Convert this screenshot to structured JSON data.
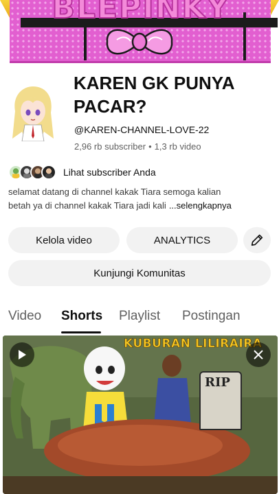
{
  "banner": {
    "text": "BLEPINKY"
  },
  "channel": {
    "name": "KAREN GK PUNYA PACAR?",
    "handle": "@KAREN-CHANNEL-LOVE-22",
    "subscribers": "2,96 rb subscriber",
    "separator": "•",
    "videos": "1,3 rb video",
    "subscribers_link": "Lihat subscriber Anda",
    "description_line1": "selamat datang di channel kakak Tiara semoga kalian",
    "description_line2": "betah ya di channel kakak Tiara jadi kali",
    "description_more": "...selengkapnya"
  },
  "buttons": {
    "manage_videos": "Kelola video",
    "analytics": "ANALYTICS",
    "community": "Kunjungi Komunitas"
  },
  "tabs": [
    {
      "label": "Video",
      "active": false
    },
    {
      "label": "Shorts",
      "active": true
    },
    {
      "label": "Playlist",
      "active": false
    },
    {
      "label": "Postingan",
      "active": false
    }
  ],
  "thumbnail": {
    "title": "KUBURAN LILIRAIRA",
    "sign": "RIP"
  },
  "icons": {
    "edit": "pencil-icon",
    "play": "play-icon",
    "close": "close-icon"
  },
  "colors": {
    "banner_pink": "#e25fd0",
    "banner_yellow": "#f6d23a",
    "button_bg": "#f2f2f2",
    "text_secondary": "#606060"
  }
}
